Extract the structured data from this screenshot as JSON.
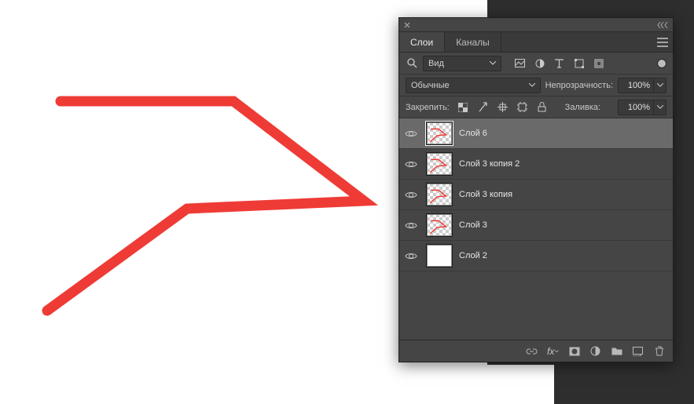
{
  "panel": {
    "tabs": [
      {
        "label": "Слои",
        "active": true
      },
      {
        "label": "Каналы",
        "active": false
      }
    ],
    "filter": {
      "kind_label": "Вид"
    },
    "blend": {
      "mode_label": "Обычные",
      "opacity_label": "Непрозрачность:",
      "opacity_value": "100%"
    },
    "lock": {
      "label": "Закрепить:",
      "fill_label": "Заливка:",
      "fill_value": "100%"
    },
    "layers": [
      {
        "name": "Слой 6",
        "thumb": "checker-stroke",
        "selected": true
      },
      {
        "name": "Слой 3 копия 2",
        "thumb": "checker-stroke",
        "selected": false
      },
      {
        "name": "Слой 3 копия",
        "thumb": "checker-stroke",
        "selected": false
      },
      {
        "name": "Слой 3",
        "thumb": "checker-stroke",
        "selected": false
      },
      {
        "name": "Слой 2",
        "thumb": "white",
        "selected": false
      }
    ]
  },
  "colors": {
    "stroke": "#ef3b36",
    "panel_bg": "#454545"
  }
}
